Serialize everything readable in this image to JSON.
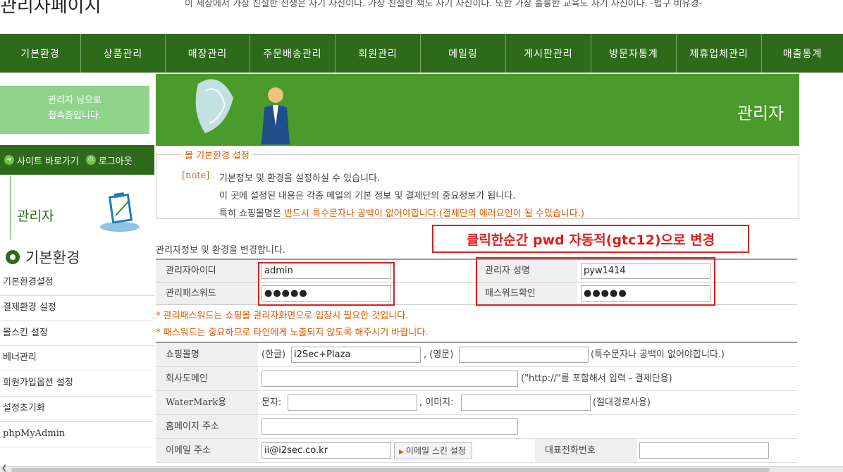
{
  "header": {
    "site_title": "관리자페이지",
    "quote": "이 세상에서 가장 친절한 선생은 자기 자신이다. 가장 친절한 책도 자기 자신이다. 또한 가장 훌륭한 교육도 자기 자신이다. -법구 비유경-"
  },
  "nav": [
    "기본환경",
    "상품관리",
    "매장관리",
    "주문배송관리",
    "회원관리",
    "메일링",
    "게시판관리",
    "방문자통계",
    "제휴업체관리",
    "매출통계"
  ],
  "sidebar": {
    "login_line1": "관리자 님으로",
    "login_line2": "접속중입니다.",
    "site_shortcut": "사이트 바로가기",
    "logout": "로그아웃",
    "admin_label": "관리자",
    "section_title": "기본환경",
    "menu": [
      "기본환경설정",
      "결제환경 설정",
      "몰스킨 설정",
      "베너관리",
      "회원가입옵션 설정",
      "설정초기화",
      "phpMyAdmin"
    ]
  },
  "banner": {
    "title": "관리자"
  },
  "notice": {
    "legend": "몰 기본환경 설정",
    "tag": "[note]",
    "line1": "기본정보 및 환경을 설정하실 수 있습니다.",
    "line2": "이 곳에 설정된 내용은 각종 메일의 기본 정보 및 결제단의 중요정보가 됩니다.",
    "line3_prefix": "특히 쇼핑몰명은 ",
    "line3_highlight": "반드시 특수문자나 공백이 없어야합니다.(결제단의 에러요인이 될 수있습니다.)"
  },
  "callout": "클릭한순간 pwd 자동적(gtc12)으로 변경",
  "admin_form": {
    "intro": "관리자정보 및 환경을 변경합니다.",
    "id_label": "관리자아이디",
    "id_value": "admin",
    "pw_label": "관리패스워드",
    "pw_value": "●●●●●",
    "name_label": "관리자 성명",
    "name_value": "pyw1414",
    "pw_confirm_label": "패스워드확인",
    "pw_confirm_value": "●●●●●",
    "warn1": "* 관리패스워드는 쇼핑몰 관리자화면으로 입장시 필요한 것입니다.",
    "warn2": "* 패스워드는 중요하므로 타인에게 노출되지 않도록 해주시기 바랍니다."
  },
  "shop_form": {
    "shop_name_label": "쇼핑몰명",
    "kor_prefix": "(한글)",
    "kor_value": "i2Sec+Plaza",
    "eng_prefix": ", (영문)",
    "eng_value": "",
    "name_hint": "(특수문자나 공백이 없어야합니다.)",
    "domain_label": "회사도메인",
    "domain_value": "",
    "domain_hint": "(\"http://\"를 포함해서 입력 - 결제단용)",
    "watermark_label": "WaterMark용",
    "wm_text_prefix": "문자:",
    "wm_text_value": "",
    "wm_img_prefix": ", 이미지:",
    "wm_img_value": "",
    "wm_hint": "(절대경로사용)",
    "homepage_label": "홈페이지 주소",
    "homepage_value": "",
    "email_label": "이메일 주소",
    "email_value": "ii@i2sec.co.kr",
    "email_skin_button": "이메일 스킨 설정",
    "phone_label": "대표전화번호",
    "phone_value": ""
  },
  "colors": {
    "nav_bg": "#2d6a1a",
    "banner_bg": "#4a9a2c",
    "login_bg": "#8fd48a",
    "warn": "#e05a00",
    "callout": "#e01d1d"
  }
}
